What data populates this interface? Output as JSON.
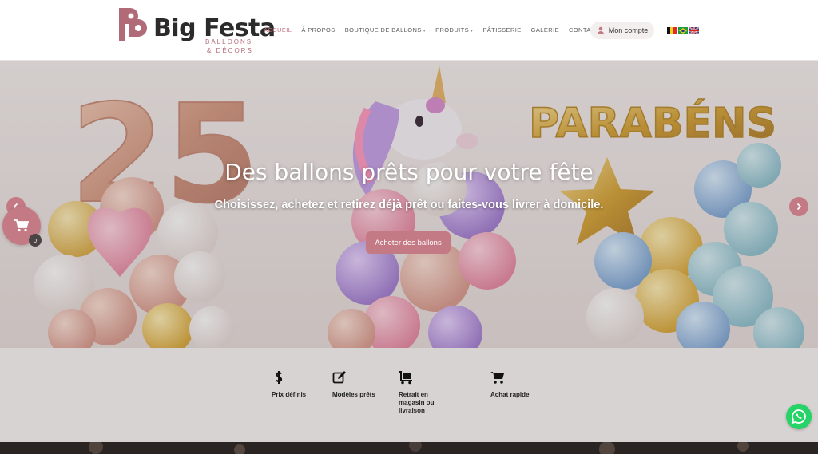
{
  "brand": {
    "name": "Big Festa",
    "tagline_line1": "BALLOONS",
    "tagline_line2": "& DÉCORS",
    "accent_color": "#c47a85"
  },
  "nav": {
    "items": [
      {
        "label": "ACCUEIL",
        "active": true
      },
      {
        "label": "À PROPOS",
        "active": false
      },
      {
        "label": "BOUTIQUE DE BALLONS",
        "active": false,
        "has_dropdown": true
      },
      {
        "label": "PRODUITS",
        "active": false,
        "has_dropdown": true
      },
      {
        "label": "PÂTISSERIE",
        "active": false
      },
      {
        "label": "GALERIE",
        "active": false
      },
      {
        "label": "CONTACT",
        "active": false
      }
    ]
  },
  "account": {
    "label": "Mon compte",
    "icon": "person-icon"
  },
  "languages": [
    "flag-belgium-icon",
    "flag-brazil-icon",
    "flag-uk-icon"
  ],
  "hero": {
    "title": "Des ballons prêts pour votre fête",
    "subtitle": "Choisissez, achetez et retirez déjà prêt ou faites-vous livrer à domicile.",
    "cta_label": "Acheter des ballons",
    "balloon_numbers": "25",
    "balloon_letters": "PARABÉNS"
  },
  "cart": {
    "count": "0",
    "icon": "cart-icon"
  },
  "features": [
    {
      "icon": "dollar-icon",
      "label": "Prix définis"
    },
    {
      "icon": "edit-icon",
      "label": "Modèles prêts"
    },
    {
      "icon": "delivery-cart-icon",
      "label": "Retrait en magasin ou livraison"
    },
    {
      "icon": "cart-icon",
      "label": "Achat rapide"
    }
  ],
  "whatsapp": {
    "icon": "whatsapp-icon"
  }
}
